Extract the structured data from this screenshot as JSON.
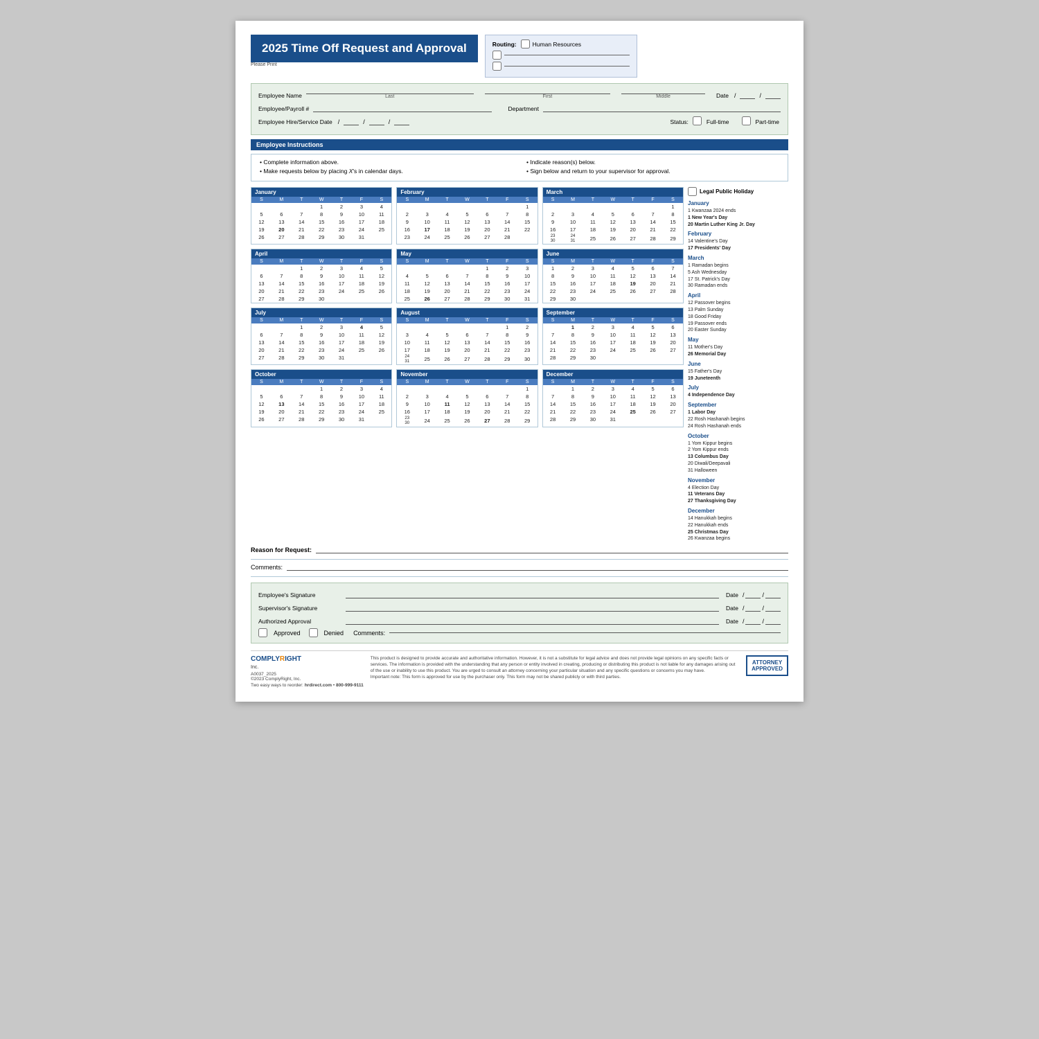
{
  "header": {
    "title": "2025 Time Off Request and Approval",
    "please_print": "Please Print",
    "routing_label": "Routing:",
    "routing_option1": "Human Resources"
  },
  "employee": {
    "name_label": "Employee Name",
    "last_label": "Last",
    "first_label": "First",
    "middle_label": "Middle",
    "date_label": "Date",
    "payroll_label": "Employee/Payroll #",
    "department_label": "Department",
    "hire_date_label": "Employee Hire/Service Date",
    "status_label": "Status:",
    "fulltime_label": "Full-time",
    "parttime_label": "Part-time"
  },
  "instructions": {
    "header": "Employee Instructions",
    "items_left": [
      "Complete information above.",
      "Make requests below by placing X's in calendar days."
    ],
    "items_right": [
      "Indicate reason(s) below.",
      "Sign below and return to your supervisor for approval."
    ]
  },
  "legal_holiday_label": "Legal Public Holiday",
  "calendars": {
    "months": [
      {
        "name": "January",
        "days": [
          [
            "",
            "",
            "",
            "1",
            "2",
            "3",
            "4"
          ],
          [
            "5",
            "6",
            "7",
            "8",
            "9",
            "10",
            "11"
          ],
          [
            "12",
            "13",
            "14",
            "15",
            "16",
            "17",
            "18"
          ],
          [
            "19",
            "20",
            "21",
            "22",
            "23",
            "24",
            "25"
          ],
          [
            "26",
            "27",
            "28",
            "29",
            "30",
            "31",
            ""
          ]
        ]
      },
      {
        "name": "February",
        "days": [
          [
            "",
            "",
            "",
            "",
            "",
            "",
            "1"
          ],
          [
            "2",
            "3",
            "4",
            "5",
            "6",
            "7",
            "8"
          ],
          [
            "9",
            "10",
            "11",
            "12",
            "13",
            "14",
            "15"
          ],
          [
            "16",
            "17",
            "18",
            "19",
            "20",
            "21",
            "22"
          ],
          [
            "23",
            "24",
            "25",
            "26",
            "27",
            "28",
            ""
          ]
        ]
      },
      {
        "name": "March",
        "days": [
          [
            "",
            "",
            "",
            "",
            "",
            "",
            "1"
          ],
          [
            "2",
            "3",
            "4",
            "5",
            "6",
            "7",
            "8"
          ],
          [
            "9",
            "10",
            "11",
            "12",
            "13",
            "14",
            "15"
          ],
          [
            "16",
            "17",
            "18",
            "19",
            "20",
            "21",
            "22"
          ],
          [
            "23/30",
            "24/31",
            "25",
            "26",
            "27",
            "28",
            "29"
          ]
        ]
      },
      {
        "name": "April",
        "days": [
          [
            "",
            "",
            "1",
            "2",
            "3",
            "4",
            "5"
          ],
          [
            "6",
            "7",
            "8",
            "9",
            "10",
            "11",
            "12"
          ],
          [
            "13",
            "14",
            "15",
            "16",
            "17",
            "18",
            "19"
          ],
          [
            "20",
            "21",
            "22",
            "23",
            "24",
            "25",
            "26"
          ],
          [
            "27",
            "28",
            "29",
            "30",
            "",
            "",
            ""
          ]
        ]
      },
      {
        "name": "May",
        "days": [
          [
            "",
            "",
            "",
            "",
            "1",
            "2",
            "3"
          ],
          [
            "4",
            "5",
            "6",
            "7",
            "8",
            "9",
            "10"
          ],
          [
            "11",
            "12",
            "13",
            "14",
            "15",
            "16",
            "17"
          ],
          [
            "18",
            "19",
            "20",
            "21",
            "22",
            "23",
            "24"
          ],
          [
            "25",
            "26",
            "27",
            "28",
            "29",
            "30",
            "31"
          ]
        ]
      },
      {
        "name": "June",
        "days": [
          [
            "1",
            "2",
            "3",
            "4",
            "5",
            "6",
            "7"
          ],
          [
            "8",
            "9",
            "10",
            "11",
            "12",
            "13",
            "14"
          ],
          [
            "15",
            "16",
            "17",
            "18",
            "19",
            "20",
            "21"
          ],
          [
            "22",
            "23",
            "24",
            "25",
            "26",
            "27",
            "28"
          ],
          [
            "29",
            "30",
            "",
            "",
            "",
            "",
            ""
          ]
        ]
      },
      {
        "name": "July",
        "days": [
          [
            "",
            "",
            "1",
            "2",
            "3",
            "4",
            "5"
          ],
          [
            "6",
            "7",
            "8",
            "9",
            "10",
            "11",
            "12"
          ],
          [
            "13",
            "14",
            "15",
            "16",
            "17",
            "18",
            "19"
          ],
          [
            "20",
            "21",
            "22",
            "23",
            "24",
            "25",
            "26"
          ],
          [
            "27",
            "28",
            "29",
            "30",
            "31",
            "",
            ""
          ]
        ]
      },
      {
        "name": "August",
        "days": [
          [
            "",
            "",
            "",
            "",
            "",
            "1",
            "2"
          ],
          [
            "3",
            "4",
            "5",
            "6",
            "7",
            "8",
            "9"
          ],
          [
            "10",
            "11",
            "12",
            "13",
            "14",
            "15",
            "16"
          ],
          [
            "17",
            "18",
            "19",
            "20",
            "21",
            "22",
            "23"
          ],
          [
            "24/31",
            "25",
            "26",
            "27",
            "28",
            "29",
            "30"
          ]
        ]
      },
      {
        "name": "September",
        "days": [
          [
            "",
            "1",
            "2",
            "3",
            "4",
            "5",
            "6"
          ],
          [
            "7",
            "8",
            "9",
            "10",
            "11",
            "12",
            "13"
          ],
          [
            "14",
            "15",
            "16",
            "17",
            "18",
            "19",
            "20"
          ],
          [
            "21",
            "22",
            "23",
            "24",
            "25",
            "26",
            "27"
          ],
          [
            "28",
            "29",
            "30",
            "",
            "",
            "",
            ""
          ]
        ]
      },
      {
        "name": "October",
        "days": [
          [
            "",
            "",
            "",
            "1",
            "2",
            "3",
            "4"
          ],
          [
            "5",
            "6",
            "7",
            "8",
            "9",
            "10",
            "11"
          ],
          [
            "12",
            "13",
            "14",
            "15",
            "16",
            "17",
            "18"
          ],
          [
            "19",
            "20",
            "21",
            "22",
            "23",
            "24",
            "25"
          ],
          [
            "26",
            "27",
            "28",
            "29",
            "30",
            "31",
            ""
          ]
        ]
      },
      {
        "name": "November",
        "days": [
          [
            "",
            "",
            "",
            "",
            "",
            "",
            "1"
          ],
          [
            "2",
            "3",
            "4",
            "5",
            "6",
            "7",
            "8"
          ],
          [
            "9",
            "10",
            "11",
            "12",
            "13",
            "14",
            "15"
          ],
          [
            "16",
            "17",
            "18",
            "19",
            "20",
            "21",
            "22"
          ],
          [
            "23/30",
            "24",
            "25",
            "26",
            "27",
            "28",
            "29"
          ]
        ]
      },
      {
        "name": "December",
        "days": [
          [
            "",
            "1",
            "2",
            "3",
            "4",
            "5",
            "6"
          ],
          [
            "7",
            "8",
            "9",
            "10",
            "11",
            "12",
            "13"
          ],
          [
            "14",
            "15",
            "16",
            "17",
            "18",
            "19",
            "20"
          ],
          [
            "21",
            "22",
            "23",
            "24",
            "25",
            "26",
            "27"
          ],
          [
            "28",
            "29",
            "30",
            "31",
            "",
            "",
            ""
          ]
        ]
      }
    ],
    "days_header": [
      "S",
      "M",
      "T",
      "W",
      "T",
      "F",
      "S"
    ]
  },
  "holidays": {
    "months": [
      {
        "month": "January",
        "items": [
          {
            "day": "1",
            "name": "Kwanzaa 2024 ends",
            "bold": false
          },
          {
            "day": "1",
            "name": "New Year's Day",
            "bold": true
          },
          {
            "day": "20",
            "name": "Martin Luther King Jr. Day",
            "bold": true
          }
        ]
      },
      {
        "month": "February",
        "items": [
          {
            "day": "14",
            "name": "Valentine's Day",
            "bold": false
          },
          {
            "day": "17",
            "name": "Presidents' Day",
            "bold": true
          }
        ]
      },
      {
        "month": "March",
        "items": [
          {
            "day": "1",
            "name": "Ramadan begins",
            "bold": false
          },
          {
            "day": "5",
            "name": "Ash Wednesday",
            "bold": false
          },
          {
            "day": "17",
            "name": "St. Patrick's Day",
            "bold": false
          },
          {
            "day": "30",
            "name": "Ramadan ends",
            "bold": false
          }
        ]
      },
      {
        "month": "April",
        "items": [
          {
            "day": "12",
            "name": "Passover begins",
            "bold": false
          },
          {
            "day": "13",
            "name": "Palm Sunday",
            "bold": false
          },
          {
            "day": "18",
            "name": "Good Friday",
            "bold": false
          },
          {
            "day": "19",
            "name": "Passover ends",
            "bold": false
          },
          {
            "day": "20",
            "name": "Easter Sunday",
            "bold": false
          }
        ]
      },
      {
        "month": "May",
        "items": [
          {
            "day": "11",
            "name": "Mother's Day",
            "bold": false
          },
          {
            "day": "26",
            "name": "Memorial Day",
            "bold": true
          }
        ]
      },
      {
        "month": "June",
        "items": [
          {
            "day": "15",
            "name": "Father's Day",
            "bold": false
          },
          {
            "day": "19",
            "name": "Juneteenth",
            "bold": true
          }
        ]
      },
      {
        "month": "July",
        "items": [
          {
            "day": "4",
            "name": "Independence Day",
            "bold": true
          }
        ]
      },
      {
        "month": "September",
        "items": [
          {
            "day": "1",
            "name": "Labor Day",
            "bold": true
          },
          {
            "day": "22",
            "name": "Rosh Hashanah begins",
            "bold": false
          },
          {
            "day": "24",
            "name": "Rosh Hashanah ends",
            "bold": false
          }
        ]
      },
      {
        "month": "October",
        "items": [
          {
            "day": "1",
            "name": "Yom Kippur begins",
            "bold": false
          },
          {
            "day": "2",
            "name": "Yom Kippur ends",
            "bold": false
          },
          {
            "day": "13",
            "name": "Columbus Day",
            "bold": true
          },
          {
            "day": "20",
            "name": "Diwali/Deepavali",
            "bold": false
          },
          {
            "day": "31",
            "name": "Halloween",
            "bold": false
          }
        ]
      },
      {
        "month": "November",
        "items": [
          {
            "day": "4",
            "name": "Election Day",
            "bold": false
          },
          {
            "day": "11",
            "name": "Veterans Day",
            "bold": true
          },
          {
            "day": "27",
            "name": "Thanksgiving Day",
            "bold": true
          }
        ]
      },
      {
        "month": "December",
        "items": [
          {
            "day": "14",
            "name": "Hanukkah begins",
            "bold": false
          },
          {
            "day": "22",
            "name": "Hanukkah ends",
            "bold": false
          },
          {
            "day": "25",
            "name": "Christmas Day",
            "bold": true
          },
          {
            "day": "26",
            "name": "Kwanzaa begins",
            "bold": false
          }
        ]
      }
    ]
  },
  "reason": {
    "label": "Reason for Request:",
    "comments_label": "Comments:"
  },
  "signatures": {
    "employee_label": "Employee's Signature",
    "supervisor_label": "Supervisor's Signature",
    "authorized_label": "Authorized Approval",
    "date_label": "Date",
    "approved_label": "Approved",
    "denied_label": "Denied",
    "comments_label": "Comments:"
  },
  "footer": {
    "logo_comply": "COMPLY",
    "logo_right": "RIGHT",
    "logo_inc": "Inc.",
    "form_number": "A0037_2025",
    "copyright": "©2023 ComplyRight, Inc.",
    "reorder": "Two easy ways to reorder:",
    "website": "hrdirect.com",
    "phone": "800-999-9111",
    "disclaimer": "This product is designed to provide accurate and authoritative information. However, it is not a substitute for legal advice and does not provide legal opinions on any specific facts or services. The information is provided with the understanding that any person or entity involved in creating, producing or distributing this product is not liable for any damages arising out of the use or inability to use this product. You are urged to consult an attorney concerning your particular situation and any specific questions or concerns you may have.",
    "important": "Important note: This form is approved for use by the purchaser only. This form may not be shared publicly or with third parties.",
    "attorney_badge": "ATTORNEY\nAPPROVED"
  }
}
